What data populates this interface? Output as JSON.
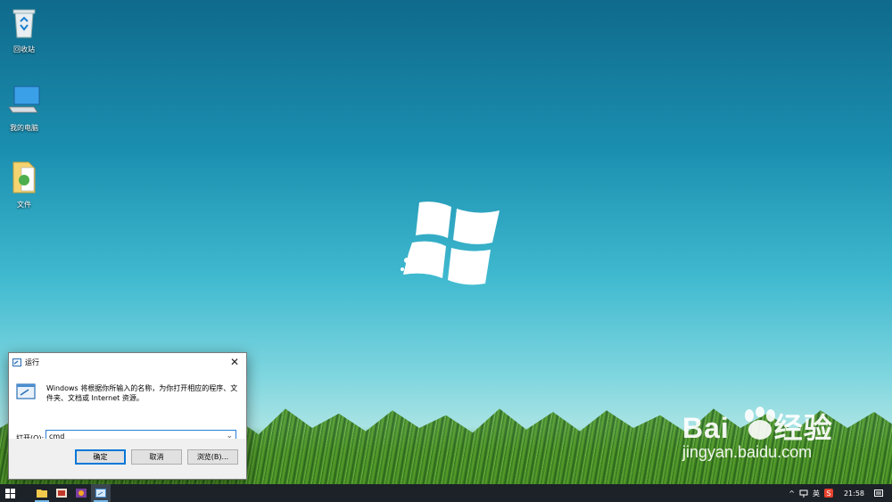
{
  "desktop": {
    "icons": [
      {
        "label": "回收站",
        "icon": "recycle-bin-icon"
      },
      {
        "label": "我的电脑",
        "icon": "computer-icon"
      },
      {
        "label": "文件",
        "icon": "folder-icon"
      }
    ]
  },
  "run_dialog": {
    "title": "运行",
    "description": "Windows 将根据你所输入的名称，为你打开相应的程序、文件夹、文档或 Internet 资源。",
    "open_label": "打开(O):",
    "open_value": "cmd",
    "ok_label": "确定",
    "cancel_label": "取消",
    "browse_label": "浏览(B)..."
  },
  "taskbar": {
    "ime": "英",
    "time": "21:58"
  },
  "watermark": {
    "brand": "Bai",
    "brand_suffix": "经验",
    "url": "jingyan.baidu.com"
  },
  "colors": {
    "accent": "#0078d7",
    "taskbar": "#1c2228"
  }
}
